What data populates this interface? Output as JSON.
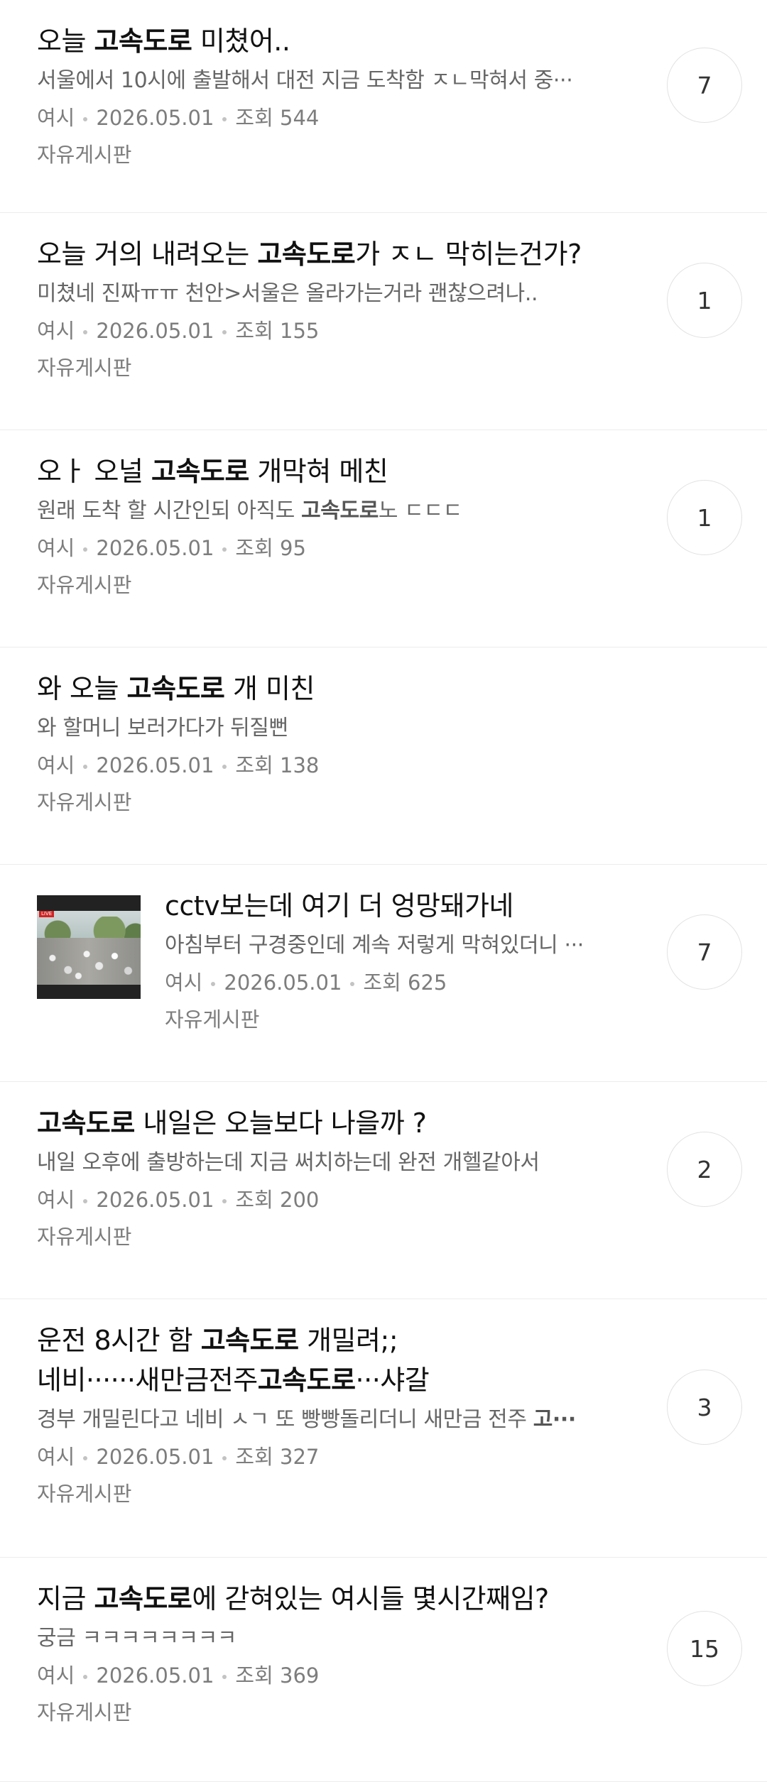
{
  "posts": [
    {
      "title_parts": [
        {
          "t": "오늘 ",
          "b": false
        },
        {
          "t": "고속도로",
          "b": true
        },
        {
          "t": " 미쳤어..",
          "b": false
        }
      ],
      "preview_parts": [
        {
          "t": "서울에서 10시에 출발해서 대전 지금 도착함 ㅈㄴ막혀서 중···",
          "b": false
        }
      ],
      "author": "여시",
      "date": "2026.05.01",
      "views": "조회 544",
      "board": "자유게시판",
      "comment_count": "7"
    },
    {
      "title_parts": [
        {
          "t": "오늘 거의 내려오는 ",
          "b": false
        },
        {
          "t": "고속도로",
          "b": true
        },
        {
          "t": "가 ㅈㄴ 막히는건가?",
          "b": false
        }
      ],
      "preview_parts": [
        {
          "t": "미쳤네 진짜ㅠㅠ 천안>서울은 올라가는거라 괜찮으려나..",
          "b": false
        }
      ],
      "author": "여시",
      "date": "2026.05.01",
      "views": "조회 155",
      "board": "자유게시판",
      "comment_count": "1"
    },
    {
      "title_parts": [
        {
          "t": "오ㅏ 오널 ",
          "b": false
        },
        {
          "t": "고속도로",
          "b": true
        },
        {
          "t": " 개막혀 메친",
          "b": false
        }
      ],
      "preview_parts": [
        {
          "t": "원래 도착 할 시간인되 아직도 ",
          "b": false
        },
        {
          "t": "고속도로",
          "b": true
        },
        {
          "t": "노 ㄷㄷㄷ",
          "b": false
        }
      ],
      "author": "여시",
      "date": "2026.05.01",
      "views": "조회 95",
      "board": "자유게시판",
      "comment_count": "1"
    },
    {
      "title_parts": [
        {
          "t": "와 오늘 ",
          "b": false
        },
        {
          "t": "고속도로",
          "b": true
        },
        {
          "t": " 개 미친",
          "b": false
        }
      ],
      "preview_parts": [
        {
          "t": "와 할머니 보러가다가 뒤질뻔",
          "b": false
        }
      ],
      "author": "여시",
      "date": "2026.05.01",
      "views": "조회 138",
      "board": "자유게시판",
      "comment_count": ""
    },
    {
      "title_parts": [
        {
          "t": "cctv보는데 여기 더 엉망돼가네",
          "b": false
        }
      ],
      "preview_parts": [
        {
          "t": "아침부터 구경중인데 계속 저렇게 막혀있더니 ···",
          "b": false
        }
      ],
      "author": "여시",
      "date": "2026.05.01",
      "views": "조회 625",
      "board": "자유게시판",
      "comment_count": "7",
      "thumbnail": true,
      "thumbnail_badge": "LIVE"
    },
    {
      "title_parts": [
        {
          "t": "고속도로",
          "b": true
        },
        {
          "t": " 내일은 오늘보다 나을까 ?",
          "b": false
        }
      ],
      "preview_parts": [
        {
          "t": "내일 오후에 출방하는데 지금 써치하는데 완전 개헬같아서",
          "b": false
        }
      ],
      "author": "여시",
      "date": "2026.05.01",
      "views": "조회 200",
      "board": "자유게시판",
      "comment_count": "2"
    },
    {
      "title_lines": [
        [
          {
            "t": "운전 8시간 함 ",
            "b": false
          },
          {
            "t": "고속도로",
            "b": true
          },
          {
            "t": " 개밀려;;",
            "b": false
          }
        ],
        [
          {
            "t": "네비······새만금전주",
            "b": false
          },
          {
            "t": "고속도로",
            "b": true
          },
          {
            "t": "···샤갈",
            "b": false
          }
        ]
      ],
      "preview_parts": [
        {
          "t": "경부 개밀린다고 네비 ㅅㄱ 또 빵빵돌리더니 새만금 전주 ",
          "b": false
        },
        {
          "t": "고···",
          "b": true
        }
      ],
      "author": "여시",
      "date": "2026.05.01",
      "views": "조회 327",
      "board": "자유게시판",
      "comment_count": "3"
    },
    {
      "title_parts": [
        {
          "t": "지금 ",
          "b": false
        },
        {
          "t": "고속도로",
          "b": true
        },
        {
          "t": "에 갇혀있는 여시들 몇시간째임?",
          "b": false
        }
      ],
      "preview_parts": [
        {
          "t": "궁금 ㅋㅋㅋㅋㅋㅋㅋㅋ",
          "b": false
        }
      ],
      "author": "여시",
      "date": "2026.05.01",
      "views": "조회 369",
      "board": "자유게시판",
      "comment_count": "15"
    }
  ]
}
